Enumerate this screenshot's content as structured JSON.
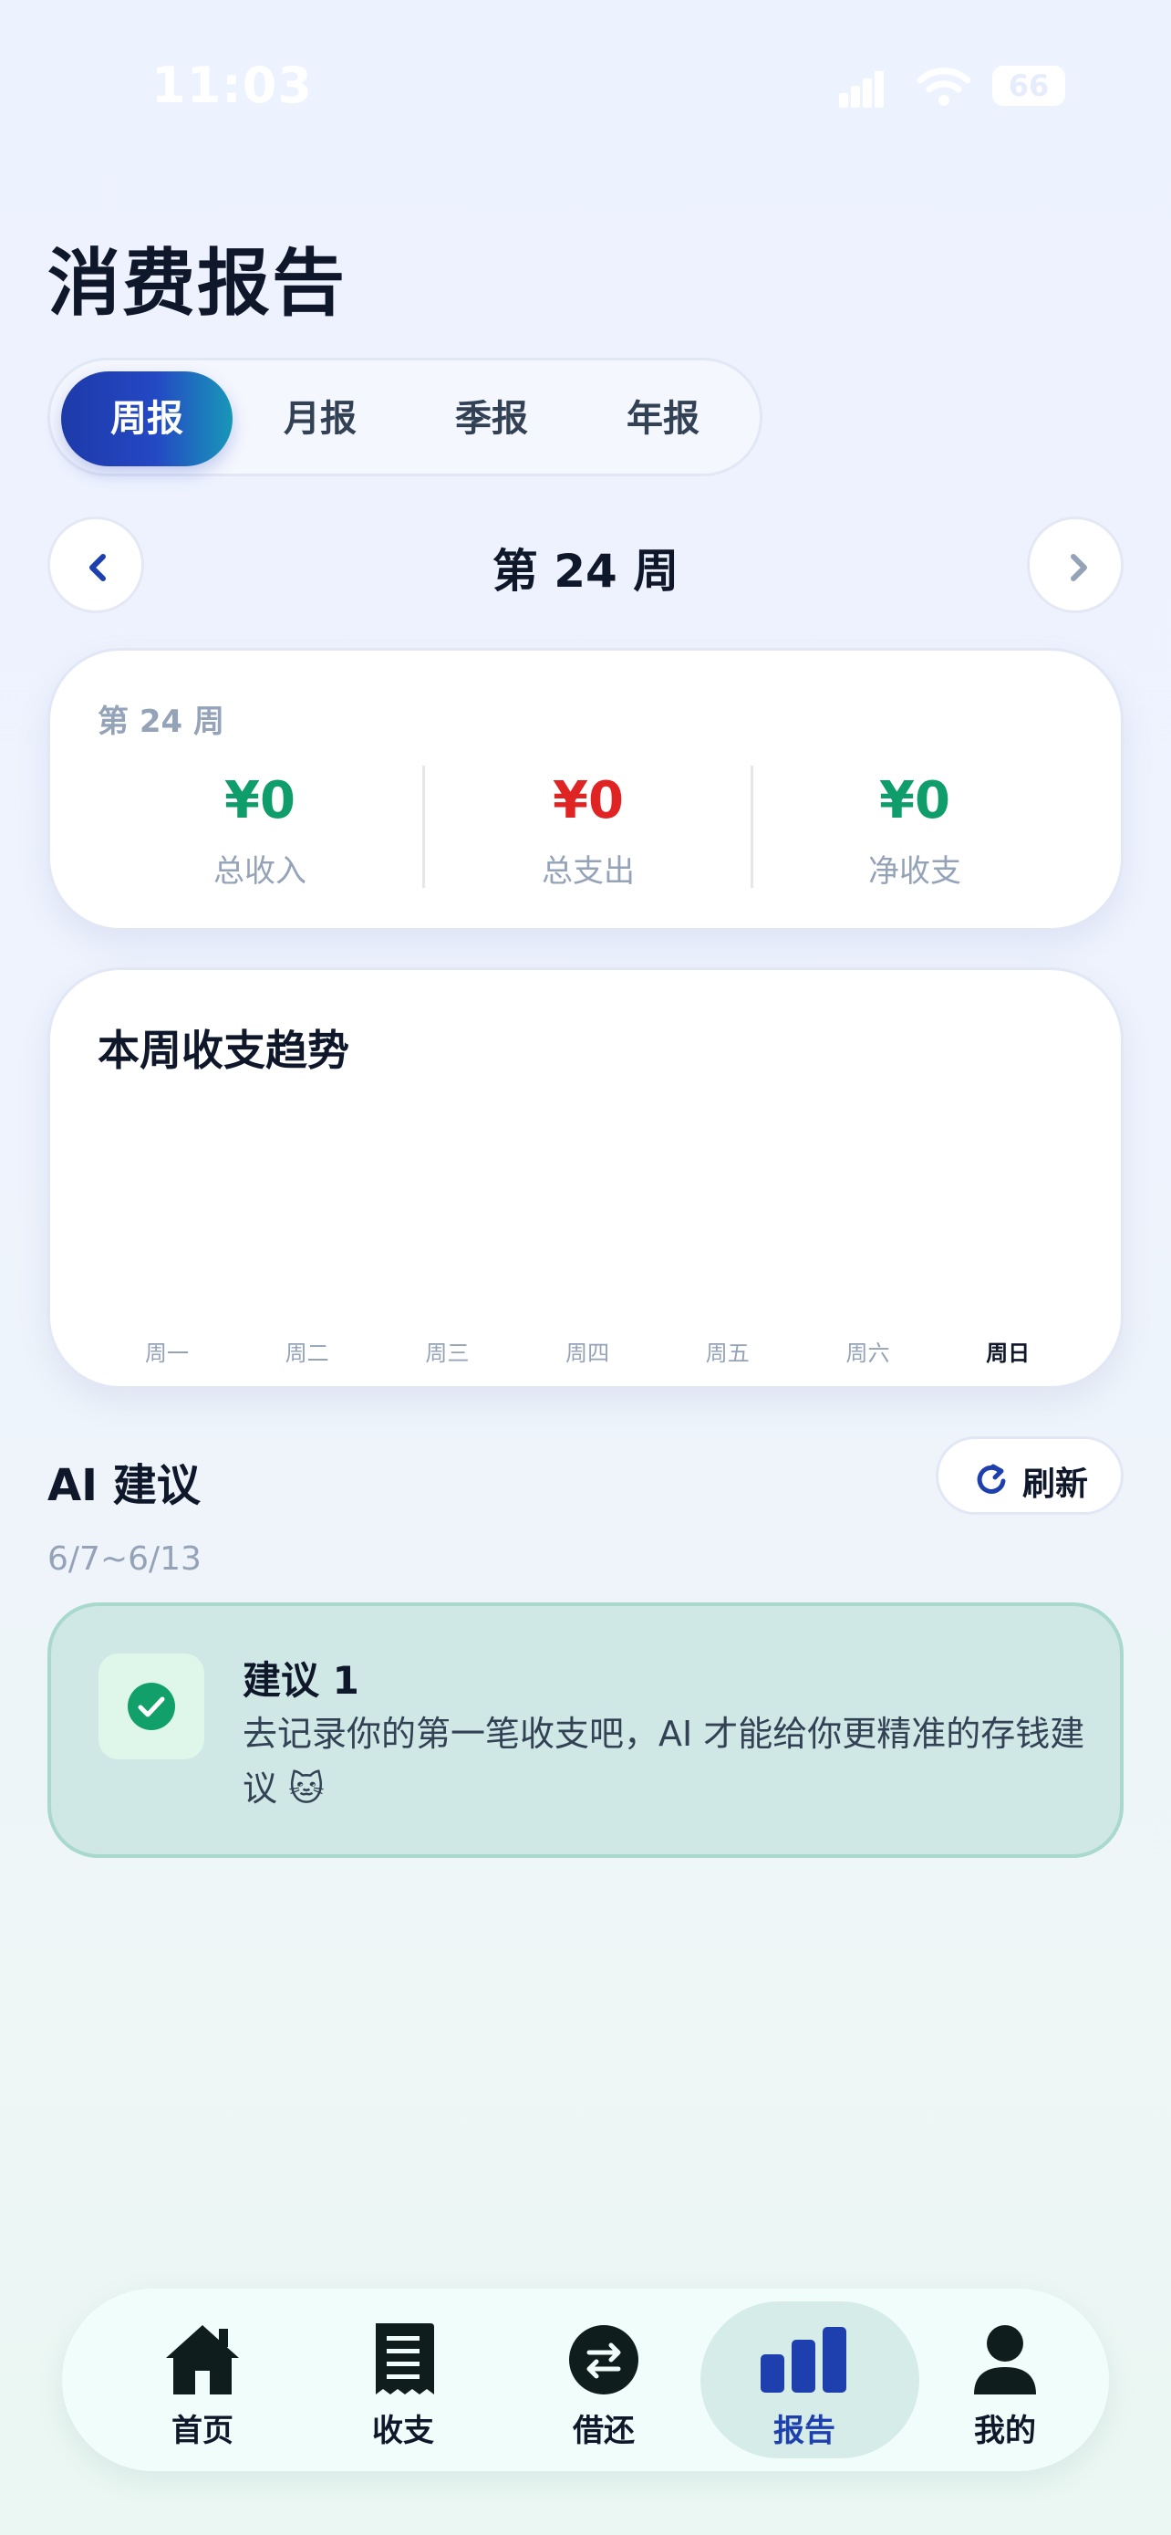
{
  "status_bar": {
    "time": "11:03",
    "battery": "66"
  },
  "page": {
    "title": "消费报告"
  },
  "period_tabs": [
    {
      "label": "周报",
      "active": true
    },
    {
      "label": "月报",
      "active": false
    },
    {
      "label": "季报",
      "active": false
    },
    {
      "label": "年报",
      "active": false
    }
  ],
  "week_nav": {
    "title": "第 24 周"
  },
  "summary": {
    "label": "第 24 周",
    "income": {
      "value": "¥0",
      "label": "总收入",
      "color": "#0f9d6b"
    },
    "expense": {
      "value": "¥0",
      "label": "总支出",
      "color": "#e02424"
    },
    "net": {
      "value": "¥0",
      "label": "净收支",
      "color": "#0f9d6b"
    }
  },
  "trend": {
    "title": "本周收支趋势",
    "days": [
      "周一",
      "周二",
      "周三",
      "周四",
      "周五",
      "周六",
      "周日"
    ],
    "active_day": "周日"
  },
  "chart_data": {
    "type": "bar",
    "title": "本周收支趋势",
    "categories": [
      "周一",
      "周二",
      "周三",
      "周四",
      "周五",
      "周六",
      "周日"
    ],
    "series": [
      {
        "values": [
          0,
          0,
          0,
          0,
          0,
          0,
          0
        ]
      }
    ]
  },
  "ai": {
    "title": "AI 建议",
    "refresh_label": "刷新",
    "date_range": "6/7~6/13",
    "suggestion": {
      "title": "建议 1",
      "text": "去记录你的第一笔收支吧，AI 才能给你更精准的存钱建议 🐱"
    }
  },
  "tabbar": [
    {
      "label": "首页",
      "icon": "home-icon",
      "active": false
    },
    {
      "label": "收支",
      "icon": "receipt-icon",
      "active": false
    },
    {
      "label": "借还",
      "icon": "exchange-icon",
      "active": false
    },
    {
      "label": "报告",
      "icon": "bar-chart-icon",
      "active": true
    },
    {
      "label": "我的",
      "icon": "user-icon",
      "active": false
    }
  ],
  "colors": {
    "accent": "#1e3fae",
    "income": "#0f9d6b",
    "expense": "#e02424"
  }
}
